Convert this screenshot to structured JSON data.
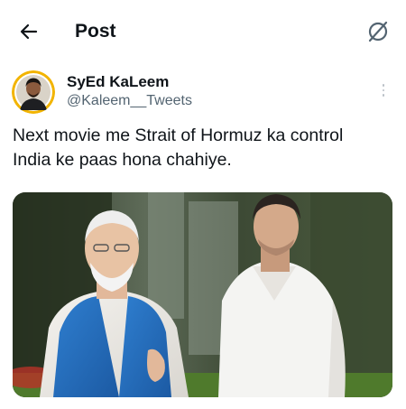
{
  "header": {
    "title": "Post",
    "back_icon": "arrow-left-icon",
    "grok_icon": "grok-icon"
  },
  "author": {
    "display_name": "SyEd KaLeem",
    "handle": "@Kaleem__Tweets",
    "avatar_ring_color": "#f2b400",
    "more_icon": "more-vertical-icon"
  },
  "post": {
    "text": "Next movie me Strait of Hormuz ka control\nIndia ke paas hona chahiye.",
    "media_description_icon": "photo"
  },
  "colors": {
    "text_primary": "#0f1419",
    "text_secondary": "#536471",
    "background": "#ffffff"
  }
}
